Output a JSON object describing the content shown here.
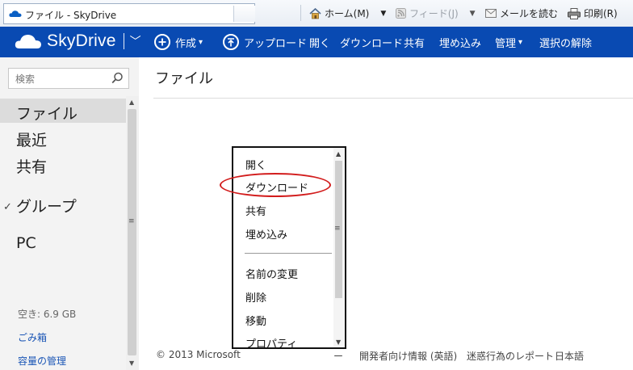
{
  "browser": {
    "tab_title": "ファイル - SkyDrive",
    "commands": {
      "home": "ホーム(M)",
      "feeds": "フィード(J)",
      "read_mail": "メールを読む",
      "print": "印刷(R)"
    }
  },
  "header": {
    "brand": "SkyDrive",
    "commands": {
      "create": "作成",
      "upload": "アップロード",
      "open": "開く",
      "download": "ダウンロード",
      "share": "共有",
      "embed": "埋め込み",
      "manage": "管理",
      "deselect": "選択の解除"
    }
  },
  "sidebar": {
    "search_placeholder": "検索",
    "items": {
      "files": "ファイル",
      "recent": "最近",
      "shared": "共有",
      "groups": "グループ",
      "pc": "PC"
    },
    "storage_free": "空き: 6.9 GB",
    "recycle_bin": "ごみ箱",
    "manage_storage": "容量の管理"
  },
  "main": {
    "title": "ファイル"
  },
  "context_menu": {
    "items": {
      "open": "開く",
      "download": "ダウンロード",
      "share": "共有",
      "embed": "埋め込み",
      "rename": "名前の変更",
      "delete": "削除",
      "move": "移動",
      "properties": "プロパティ"
    }
  },
  "footer": {
    "copyright": "© 2013 Microsoft",
    "dash": "ー",
    "developers": "開発者向け情報 (英語)",
    "report_abuse": "迷惑行為のレポート",
    "language": "日本語"
  },
  "colors": {
    "header_bg": "#094ab2",
    "annotation": "#d21c1c"
  }
}
